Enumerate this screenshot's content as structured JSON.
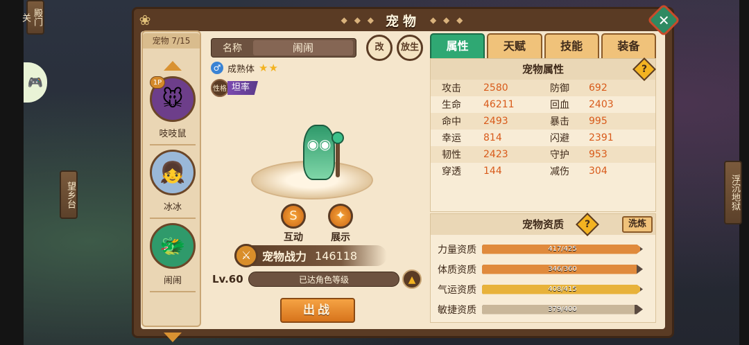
{
  "window": {
    "title": "宠物"
  },
  "map_signs": {
    "top_left": "殿门关",
    "left": "望乡台",
    "right": "浮沉地狱"
  },
  "pet_list": {
    "count_label": "宠物 7/15",
    "badge": "1P",
    "items": [
      {
        "name": "吱吱鼠",
        "icon": "rat-avatar-icon",
        "color": "#6d3e8a"
      },
      {
        "name": "冰冰",
        "icon": "ice-girl-avatar-icon",
        "color": "#9ab8d8"
      },
      {
        "name": "闹闹",
        "icon": "green-dragon-avatar-icon",
        "color": "#2f9a6b"
      }
    ]
  },
  "detail": {
    "name_label": "名称",
    "name_value": "闹闹",
    "rename_button": "改",
    "release_button": "放生",
    "stage": "成熟体",
    "stars": "★★",
    "trait_icon_label": "性格",
    "trait": "坦率",
    "interact_label": "互动",
    "display_label": "展示",
    "power_label": "宠物战力",
    "power_value": "146118",
    "level": "Lv.60",
    "level_status": "已达角色等级",
    "fight_button": "出战"
  },
  "tabs": [
    {
      "label": "属性",
      "active": true
    },
    {
      "label": "天赋",
      "active": false
    },
    {
      "label": "技能",
      "active": false
    },
    {
      "label": "装备",
      "active": false
    }
  ],
  "attributes": {
    "title": "宠物属性",
    "help": "?",
    "rows": [
      {
        "n1": "攻击",
        "v1": "2580",
        "n2": "防御",
        "v2": "692"
      },
      {
        "n1": "生命",
        "v1": "46211",
        "n2": "回血",
        "v2": "2403"
      },
      {
        "n1": "命中",
        "v1": "2493",
        "n2": "暴击",
        "v2": "995"
      },
      {
        "n1": "幸运",
        "v1": "814",
        "n2": "闪避",
        "v2": "2391"
      },
      {
        "n1": "韧性",
        "v1": "2423",
        "n2": "守护",
        "v2": "953"
      },
      {
        "n1": "穿透",
        "v1": "144",
        "n2": "减伤",
        "v2": "304"
      }
    ]
  },
  "aptitude": {
    "title": "宠物资质",
    "help": "?",
    "refine_button": "洗炼",
    "rows": [
      {
        "name": "力量资质",
        "text": "417/425",
        "ratio": 0.981,
        "color": "#e08a3c"
      },
      {
        "name": "体质资质",
        "text": "346/360",
        "ratio": 0.961,
        "color": "#e08a3c"
      },
      {
        "name": "气运资质",
        "text": "408/415",
        "ratio": 0.983,
        "color": "#e8b23a"
      },
      {
        "name": "敏捷资质",
        "text": "379/400",
        "ratio": 0.948,
        "color": "#c9b79a"
      }
    ]
  },
  "colors": {
    "accent_green": "#2fa873",
    "value_orange": "#d85a1a",
    "panel_brown": "#5a3b24"
  }
}
